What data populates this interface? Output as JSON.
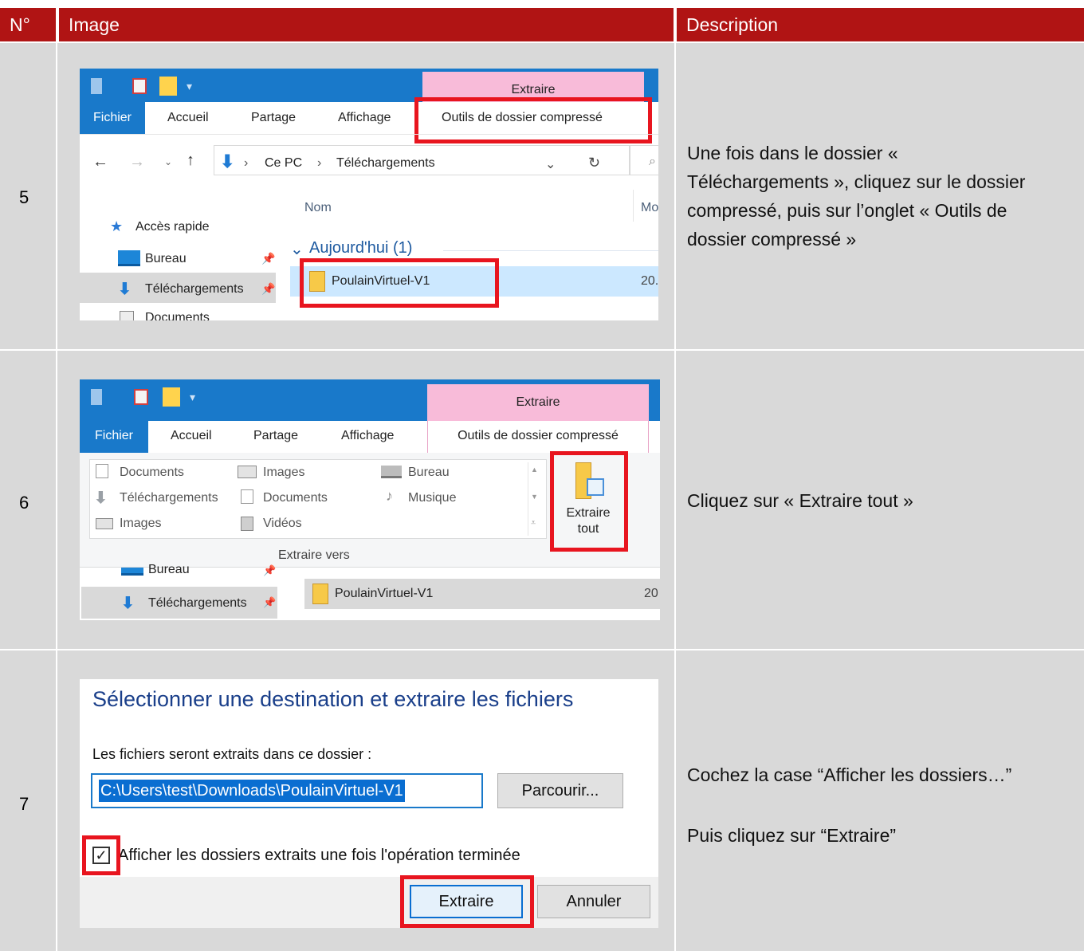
{
  "header": {
    "num": "N°",
    "image": "Image",
    "description": "Description"
  },
  "rows": [
    {
      "num": "5",
      "description": "Une fois dans le dossier « Téléchargements », cliquez sur le dossier compressé, puis sur l’onglet « Outils de dossier compressé »",
      "shot": {
        "context_tab": "Extraire",
        "tabs": [
          "Fichier",
          "Accueil",
          "Partage",
          "Affichage",
          "Outils de dossier compressé"
        ],
        "path": [
          "Ce PC",
          "Téléchargements"
        ],
        "col_name": "Nom",
        "col_date": "Mo",
        "quick_access": "Accès rapide",
        "nav": [
          "Bureau",
          "Téléchargements",
          "Documents"
        ],
        "group": "Aujourd'hui (1)",
        "file": "PoulainVirtuel-V1",
        "file_meta": "20."
      }
    },
    {
      "num": "6",
      "description": "Cliquez sur « Extraire tout »",
      "shot": {
        "context_tab": "Extraire",
        "tabs": [
          "Fichier",
          "Accueil",
          "Partage",
          "Affichage",
          "Outils de dossier compressé"
        ],
        "destinations": [
          [
            "Documents",
            "Images",
            "Bureau"
          ],
          [
            "Téléchargements",
            "Documents",
            "Musique"
          ],
          [
            "Images",
            "Vidéos",
            ""
          ]
        ],
        "group_label": "Extraire vers",
        "extract_all": [
          "Extraire",
          "tout"
        ],
        "nav": [
          "Bureau",
          "Téléchargements"
        ],
        "file": "PoulainVirtuel-V1",
        "file_meta": "20"
      }
    },
    {
      "num": "7",
      "description1": "Cochez la case “Afficher les dossiers…”",
      "description2": "Puis cliquez sur “Extraire”",
      "shot": {
        "title": "Sélectionner une destination et extraire les fichiers",
        "prompt": "Les fichiers seront extraits dans ce dossier :",
        "path_value": "C:\\Users\\test\\Downloads\\PoulainVirtuel-V1",
        "browse": "Parcourir...",
        "checkbox_label": "Afficher les dossiers extraits une fois l'opération terminée",
        "checkbox_checked": true,
        "extract": "Extraire",
        "cancel": "Annuler"
      }
    }
  ]
}
